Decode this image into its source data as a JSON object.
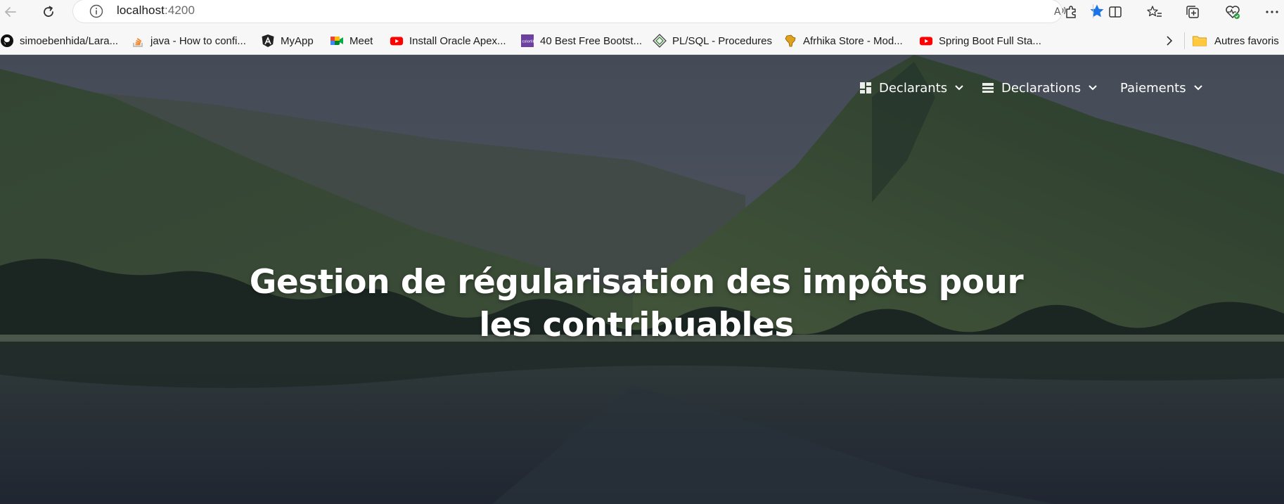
{
  "browser": {
    "url_host": "localhost",
    "url_port": ":4200"
  },
  "bookmarks": [
    {
      "label": "simoebenhida/Lara...",
      "icon": "github-icon"
    },
    {
      "label": "java - How to confi...",
      "icon": "stackoverflow-icon"
    },
    {
      "label": "MyApp",
      "icon": "angular-icon"
    },
    {
      "label": "Meet",
      "icon": "google-meet-icon"
    },
    {
      "label": "Install Oracle Apex...",
      "icon": "youtube-icon"
    },
    {
      "label": "40 Best Free Bootst...",
      "icon": "colorlib-icon"
    },
    {
      "label": "PL/SQL - Procedures",
      "icon": "diamond-icon"
    },
    {
      "label": "Afrhika Store - Mod...",
      "icon": "africa-icon"
    },
    {
      "label": "Spring Boot Full Sta...",
      "icon": "youtube-icon"
    }
  ],
  "bookmarks_folder": "Autres favoris",
  "nav": {
    "declarants": "Declarants",
    "declarations": "Declarations",
    "paiements": "Paiements"
  },
  "hero": {
    "title": "Gestion de régularisation des impôts pour les contribuables"
  },
  "colors": {
    "accent_star": "#1a73e8",
    "youtube": "#ff0000",
    "overlay": "#12162280"
  }
}
